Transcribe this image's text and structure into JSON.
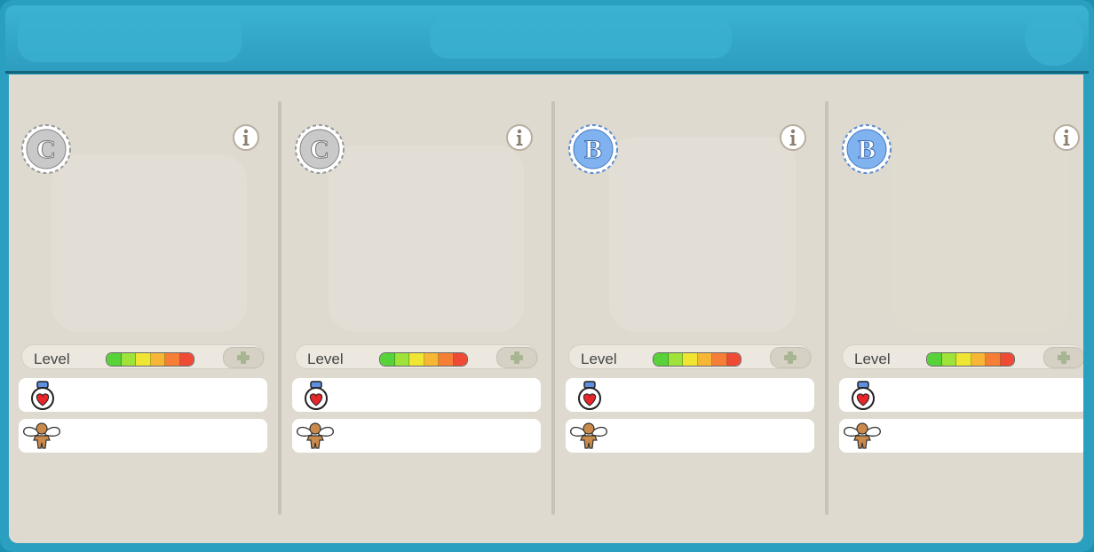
{
  "header": {
    "title": ""
  },
  "colors": {
    "frame": "#2a9fc0",
    "header": "#35aacb",
    "panel": "#dfdad0",
    "grade_c": "#c9c9c9",
    "grade_b": "#7fb2ef",
    "meter": [
      "#57d238",
      "#9fe33a",
      "#f1e534",
      "#f7b735",
      "#f77e36",
      "#ef4a35"
    ]
  },
  "cards": [
    {
      "grade": "C",
      "grade_color": "grade_c",
      "level_label": "Level",
      "potion_icon": "heart-potion-icon",
      "angel_icon": "winged-gingerbread-icon",
      "potion_value": "",
      "angel_value": ""
    },
    {
      "grade": "C",
      "grade_color": "grade_c",
      "level_label": "Level",
      "potion_icon": "heart-potion-icon",
      "angel_icon": "winged-gingerbread-icon",
      "potion_value": "",
      "angel_value": ""
    },
    {
      "grade": "B",
      "grade_color": "grade_b",
      "level_label": "Level",
      "potion_icon": "heart-potion-icon",
      "angel_icon": "winged-gingerbread-icon",
      "potion_value": "",
      "angel_value": ""
    },
    {
      "grade": "B",
      "grade_color": "grade_b",
      "level_label": "Level",
      "potion_icon": "heart-potion-icon",
      "angel_icon": "winged-gingerbread-icon",
      "potion_value": "",
      "angel_value": ""
    }
  ]
}
